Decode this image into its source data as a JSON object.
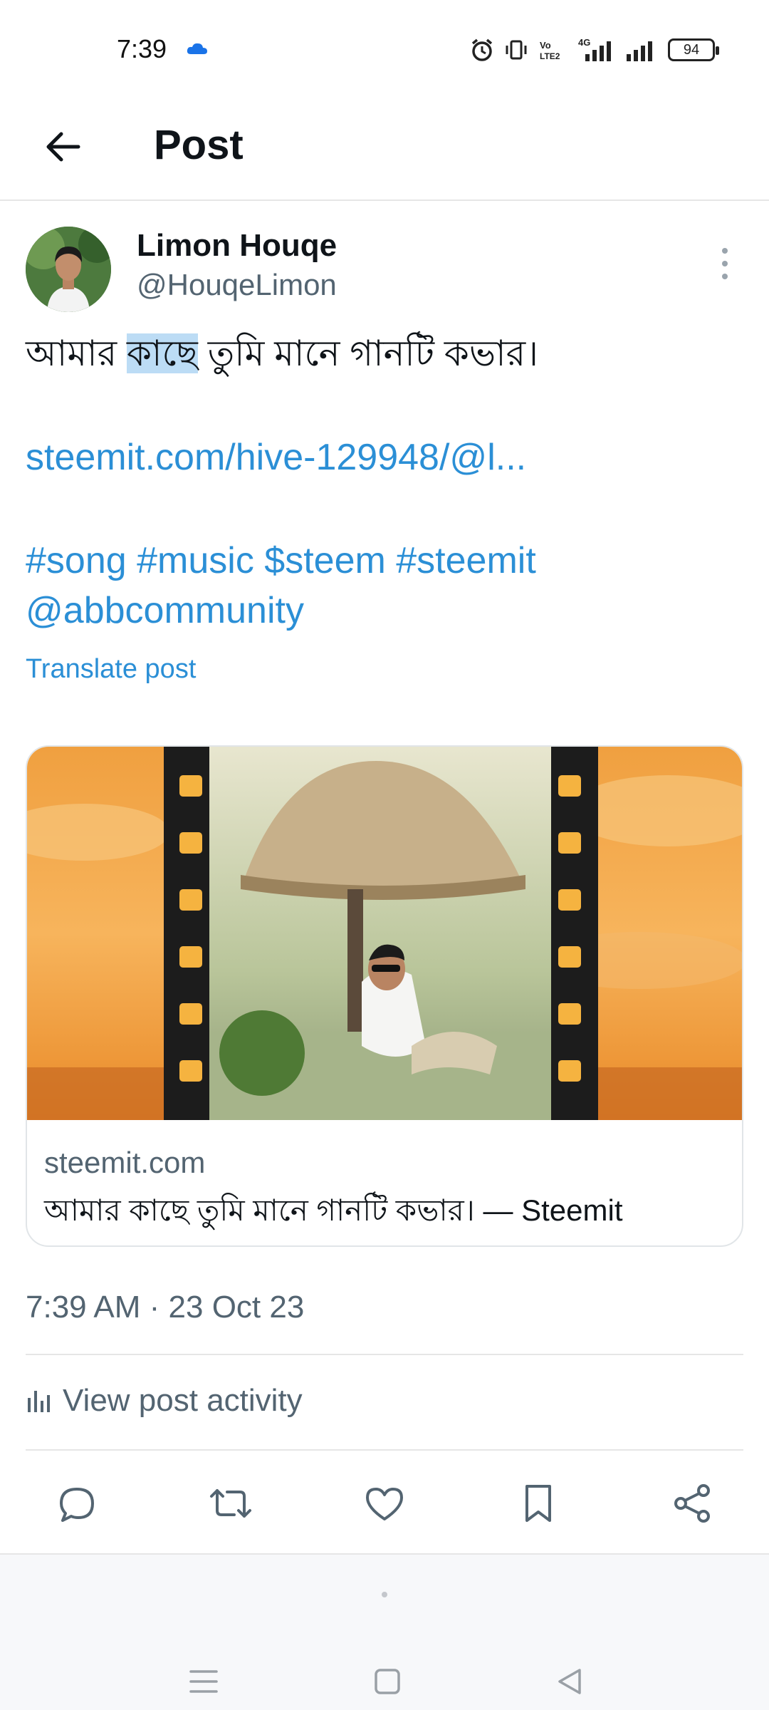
{
  "status_bar": {
    "time": "7:39",
    "battery": "94"
  },
  "header": {
    "title": "Post"
  },
  "author": {
    "name": "Limon Houqe",
    "handle": "@HouqeLimon"
  },
  "post": {
    "text_before": "আমার ",
    "text_highlight": "কাছে",
    "text_after": " তুমি মানে গানটি কভার।",
    "link": "steemit.com/hive-129948/@l...",
    "hashtags_line1": "#song #music $steem #steemit",
    "hashtags_line2": "@abbcommunity",
    "translate_label": "Translate post"
  },
  "card": {
    "domain": "steemit.com",
    "title": "আমার কাছে তুমি মানে গানটি কভার। — Steemit"
  },
  "timestamp": "7:39 AM · 23 Oct 23",
  "activity_label": "View post activity",
  "colors": {
    "accent": "#2b8fd6",
    "secondary_text": "#536471",
    "highlight": "#bcdcf5"
  },
  "icons": {
    "back": "arrow-left-icon",
    "more": "more-vertical-icon",
    "reply": "reply-icon",
    "repost": "repost-icon",
    "like": "heart-icon",
    "bookmark": "bookmark-icon",
    "share": "share-icon",
    "activity": "bar-chart-icon"
  }
}
